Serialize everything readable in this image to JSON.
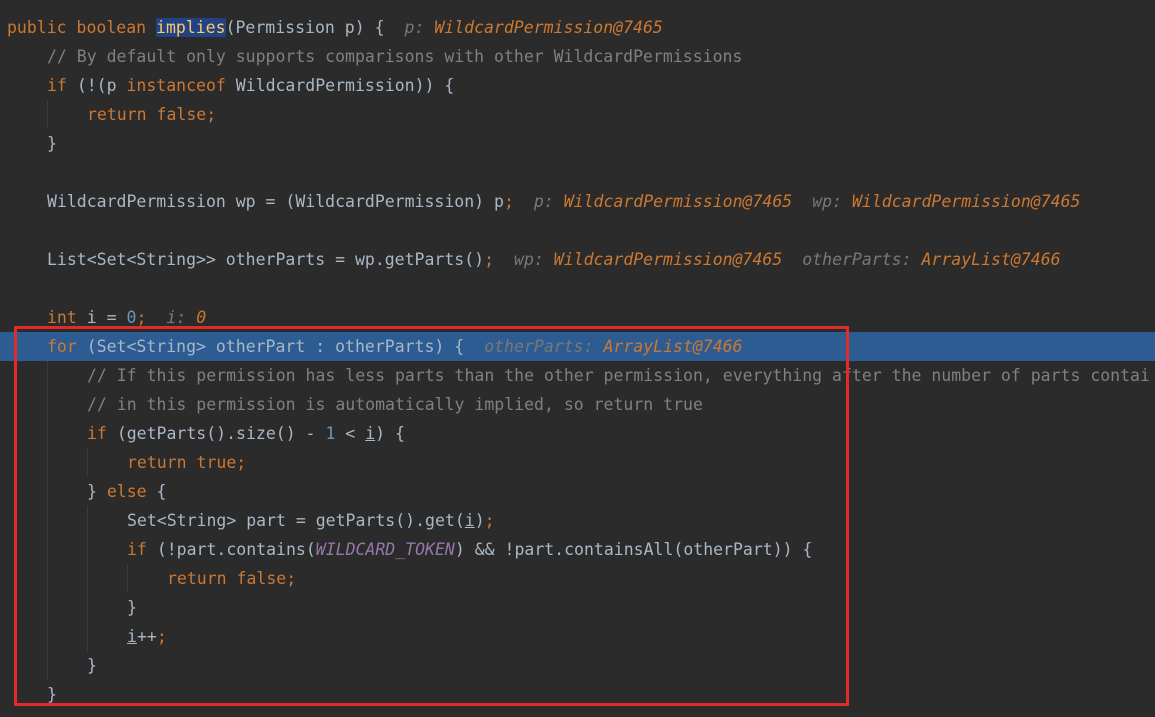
{
  "editor": {
    "language": "java",
    "highlight_color": "#e02b2b",
    "current_line_color": "#2d5c93",
    "lines": [
      {
        "indent": 0,
        "code": [
          {
            "t": "public boolean ",
            "c": "kw"
          },
          {
            "t": "implies",
            "c": "sel"
          },
          {
            "t": "(Permission p) {"
          }
        ],
        "hints": [
          {
            "label": "p:",
            "value": "WildcardPermission@7465"
          }
        ]
      },
      {
        "indent": 1,
        "code": [
          {
            "t": "// By default only supports comparisons with other WildcardPermissions",
            "c": "cm"
          }
        ]
      },
      {
        "indent": 1,
        "code": [
          {
            "t": "if ",
            "c": "kw"
          },
          {
            "t": "(!(p "
          },
          {
            "t": "instanceof ",
            "c": "kw"
          },
          {
            "t": "WildcardPermission)) {"
          }
        ]
      },
      {
        "indent": 2,
        "code": [
          {
            "t": "return false",
            "c": "kw"
          },
          {
            "t": ";",
            "c": "kw"
          }
        ]
      },
      {
        "indent": 1,
        "code": [
          {
            "t": "}"
          }
        ]
      },
      {
        "indent": 0,
        "code": []
      },
      {
        "indent": 1,
        "code": [
          {
            "t": "WildcardPermission wp = (WildcardPermission) p"
          },
          {
            "t": ";",
            "c": "kw"
          }
        ],
        "hints": [
          {
            "label": "p:",
            "value": "WildcardPermission@7465"
          },
          {
            "label": "wp:",
            "value": "WildcardPermission@7465"
          }
        ]
      },
      {
        "indent": 0,
        "code": []
      },
      {
        "indent": 1,
        "code": [
          {
            "t": "List<Set<String>> otherParts = wp.getParts()"
          },
          {
            "t": ";",
            "c": "kw"
          }
        ],
        "hints": [
          {
            "label": "wp:",
            "value": "WildcardPermission@7465"
          },
          {
            "label": "otherParts:",
            "value": "ArrayList@7466"
          }
        ]
      },
      {
        "indent": 0,
        "code": []
      },
      {
        "indent": 1,
        "code": [
          {
            "t": "int ",
            "c": "kw"
          },
          {
            "t": "i = "
          },
          {
            "t": "0",
            "c": "num"
          },
          {
            "t": ";",
            "c": "kw"
          }
        ],
        "hints": [
          {
            "label": "i:",
            "value": "0"
          }
        ]
      },
      {
        "indent": 1,
        "current": true,
        "code": [
          {
            "t": "for ",
            "c": "kw"
          },
          {
            "t": "(Set<String> otherPart : otherParts) {"
          }
        ],
        "hints": [
          {
            "label": "otherParts:",
            "value": "ArrayList@7466"
          }
        ]
      },
      {
        "indent": 2,
        "code": [
          {
            "t": "// If this permission has less parts than the other permission, everything after the number of parts contai",
            "c": "cm"
          }
        ]
      },
      {
        "indent": 2,
        "code": [
          {
            "t": "// in this permission is automatically implied, so return true",
            "c": "cm"
          }
        ]
      },
      {
        "indent": 2,
        "code": [
          {
            "t": "if ",
            "c": "kw"
          },
          {
            "t": "(getParts().size() - "
          },
          {
            "t": "1",
            "c": "num"
          },
          {
            "t": " < "
          },
          {
            "t": "i",
            "c": "ul"
          },
          {
            "t": ") {"
          }
        ]
      },
      {
        "indent": 3,
        "code": [
          {
            "t": "return true",
            "c": "kw"
          },
          {
            "t": ";",
            "c": "kw"
          }
        ]
      },
      {
        "indent": 2,
        "code": [
          {
            "t": "} "
          },
          {
            "t": "else ",
            "c": "kw"
          },
          {
            "t": "{"
          }
        ]
      },
      {
        "indent": 3,
        "code": [
          {
            "t": "Set<String> part = getParts().get("
          },
          {
            "t": "i",
            "c": "ul"
          },
          {
            "t": ")"
          },
          {
            "t": ";",
            "c": "kw"
          }
        ]
      },
      {
        "indent": 3,
        "code": [
          {
            "t": "if ",
            "c": "kw"
          },
          {
            "t": "(!part.contains("
          },
          {
            "t": "WILDCARD_TOKEN",
            "c": "const"
          },
          {
            "t": ") && !part.containsAll(otherPart)) {"
          }
        ]
      },
      {
        "indent": 4,
        "code": [
          {
            "t": "return false",
            "c": "kw"
          },
          {
            "t": ";",
            "c": "kw"
          }
        ]
      },
      {
        "indent": 3,
        "code": [
          {
            "t": "}"
          }
        ]
      },
      {
        "indent": 3,
        "code": [
          {
            "t": "i",
            "c": "ul"
          },
          {
            "t": "++"
          },
          {
            "t": ";",
            "c": "kw"
          }
        ]
      },
      {
        "indent": 2,
        "code": [
          {
            "t": "}"
          }
        ]
      },
      {
        "indent": 1,
        "code": [
          {
            "t": "}"
          }
        ]
      }
    ]
  }
}
